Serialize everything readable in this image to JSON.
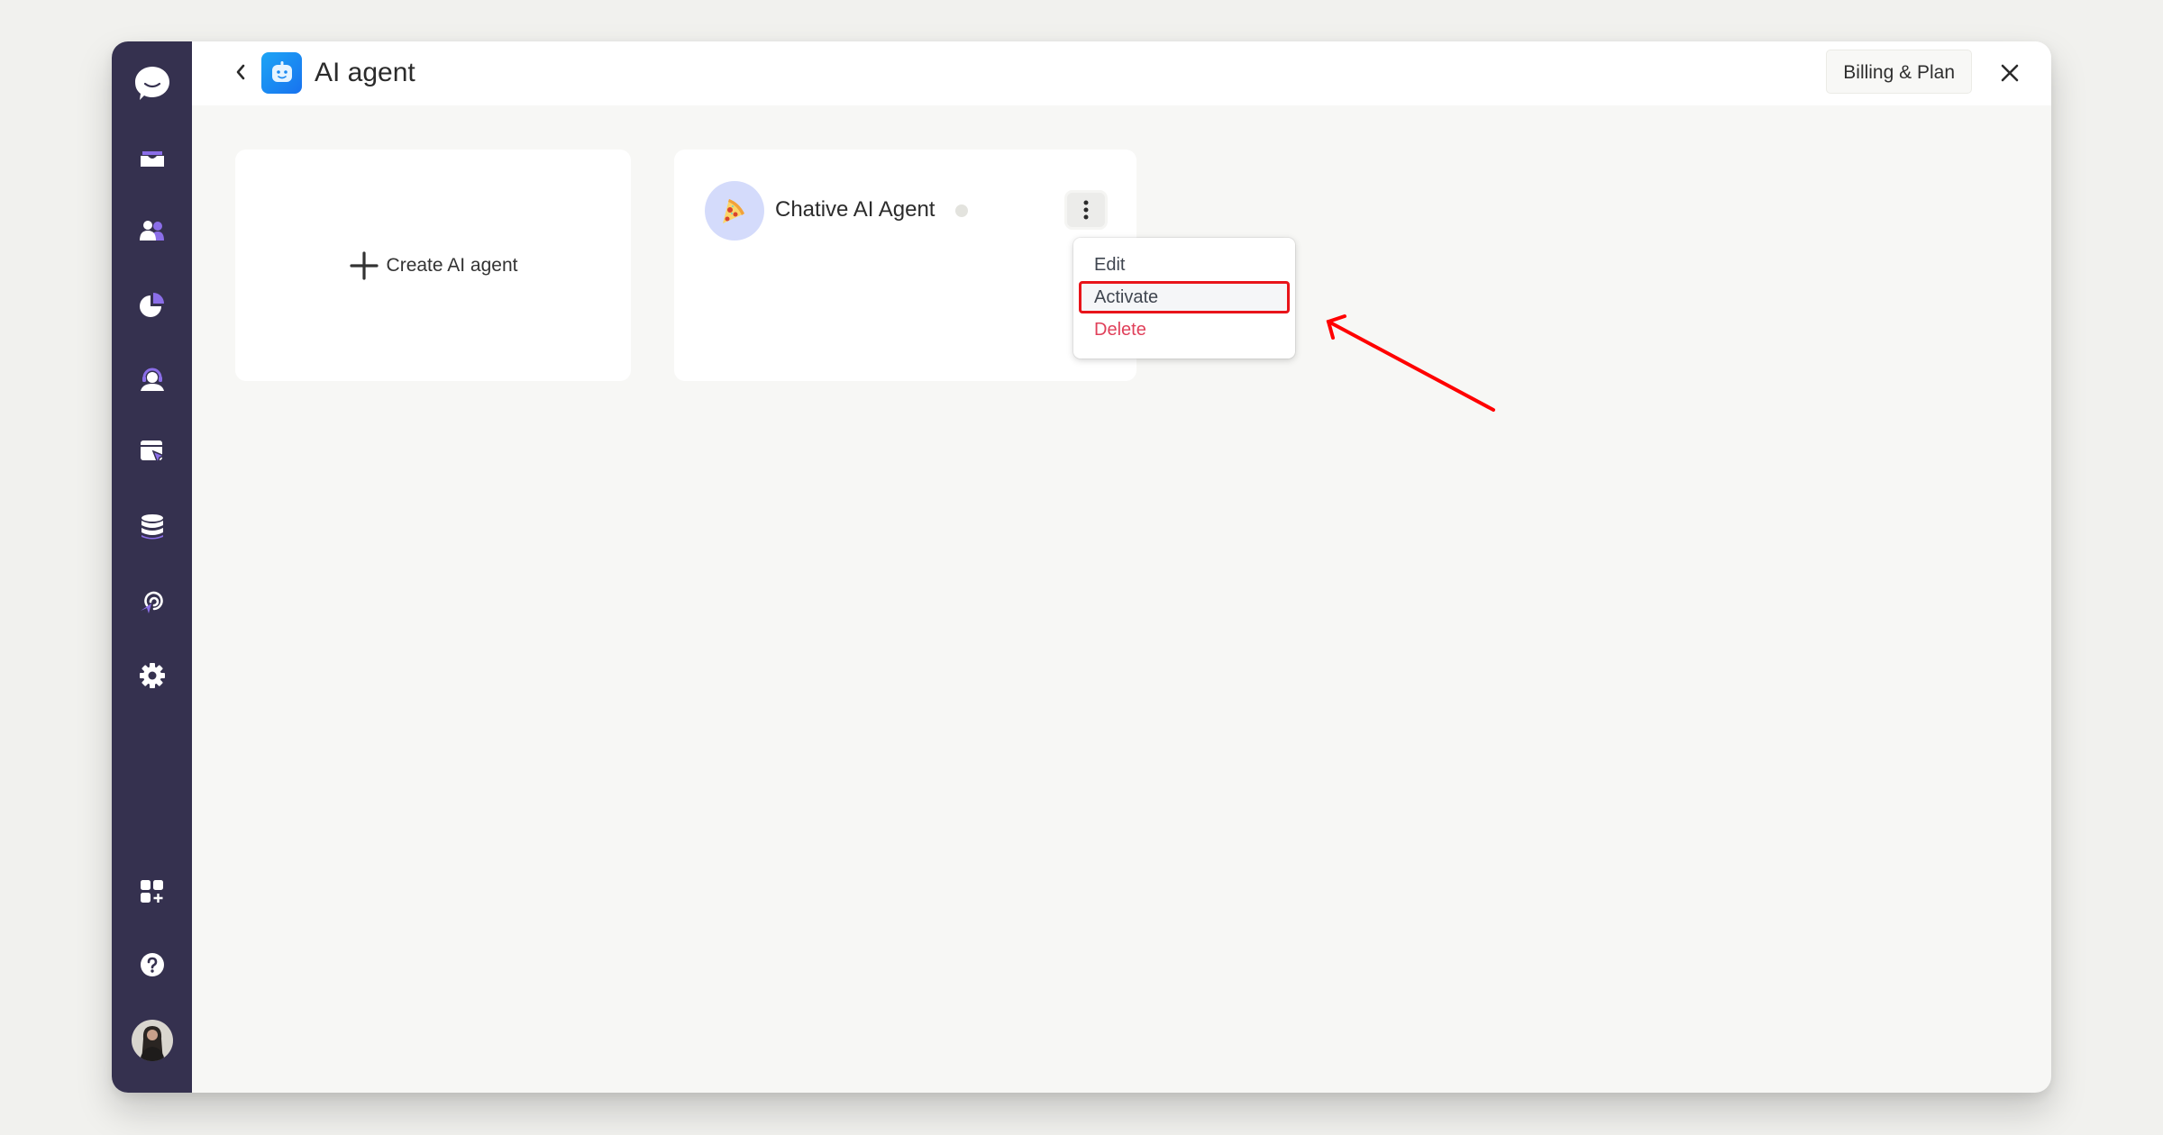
{
  "sidebar": {
    "items": [
      {
        "name": "logo",
        "icon": "chat-bubble-logo-icon"
      },
      {
        "name": "inbox",
        "icon": "inbox-icon"
      },
      {
        "name": "contacts",
        "icon": "contacts-icon"
      },
      {
        "name": "reports",
        "icon": "pie-chart-icon"
      },
      {
        "name": "ai-agent",
        "icon": "headset-agent-icon"
      },
      {
        "name": "widget",
        "icon": "widget-cursor-icon"
      },
      {
        "name": "data-sources",
        "icon": "database-icon"
      },
      {
        "name": "campaigns",
        "icon": "broadcast-icon"
      },
      {
        "name": "settings",
        "icon": "gear-icon"
      },
      {
        "name": "apps",
        "icon": "add-apps-icon"
      },
      {
        "name": "help",
        "icon": "help-icon"
      },
      {
        "name": "profile",
        "icon": "user-avatar"
      }
    ],
    "accent_color": "#8b6ee8",
    "background_color": "#35314f"
  },
  "header": {
    "title": "AI agent",
    "back_icon": "chevron-left-icon",
    "app_icon": "robot-face-icon",
    "billing_label": "Billing & Plan",
    "close_icon": "close-icon"
  },
  "cards": {
    "create_label": "Create AI agent",
    "agents": [
      {
        "name": "Chative AI Agent",
        "avatar": "pizza-slice-icon",
        "status": "inactive"
      }
    ]
  },
  "menu": {
    "items": [
      {
        "label": "Edit"
      },
      {
        "label": "Activate",
        "highlighted": true
      },
      {
        "label": "Delete",
        "danger": true
      }
    ]
  },
  "annotation": {
    "type": "arrow",
    "color": "#ff0000",
    "points_to": "Activate"
  }
}
